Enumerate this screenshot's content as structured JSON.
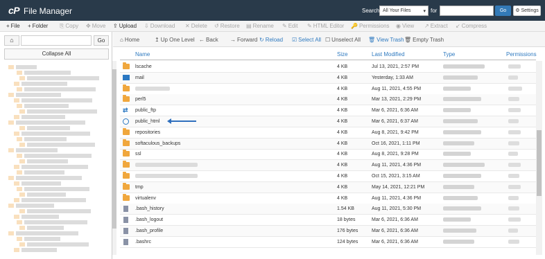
{
  "header": {
    "logo": "cP",
    "title": "File Manager",
    "search_label": "Search",
    "scope_value": "All Your Files",
    "for_label": "for",
    "go_label": "Go",
    "settings_label": "Settings"
  },
  "toolbar": [
    {
      "icon": "+",
      "label": "File",
      "enabled": true
    },
    {
      "icon": "+",
      "label": "Folder",
      "enabled": true
    },
    {
      "icon": "⎘",
      "label": "Copy",
      "enabled": false
    },
    {
      "icon": "✥",
      "label": "Move",
      "enabled": false
    },
    {
      "icon": "⇪",
      "label": "Upload",
      "enabled": true
    },
    {
      "icon": "⇩",
      "label": "Download",
      "enabled": false
    },
    {
      "icon": "✕",
      "label": "Delete",
      "enabled": false
    },
    {
      "icon": "↺",
      "label": "Restore",
      "enabled": false
    },
    {
      "icon": "▤",
      "label": "Rename",
      "enabled": false
    },
    {
      "icon": "✎",
      "label": "Edit",
      "enabled": false
    },
    {
      "icon": "✎",
      "label": "HTML Editor",
      "enabled": false
    },
    {
      "icon": "🔑",
      "label": "Permissions",
      "enabled": false
    },
    {
      "icon": "◉",
      "label": "View",
      "enabled": false
    },
    {
      "icon": "↗",
      "label": "Extract",
      "enabled": false
    },
    {
      "icon": "↙",
      "label": "Compress",
      "enabled": false
    }
  ],
  "left": {
    "go_label": "Go",
    "collapse_label": "Collapse All"
  },
  "nav": [
    {
      "icon": "⌂",
      "label": "Home",
      "style": "gray"
    },
    {
      "icon": "↥",
      "label": "Up One Level",
      "style": "gray"
    },
    {
      "icon": "←",
      "label": "Back",
      "style": "gray"
    },
    {
      "icon": "→",
      "label": "Forward",
      "style": "gray"
    },
    {
      "icon": "↻",
      "label": "Reload",
      "style": "blue"
    },
    {
      "icon": "☑",
      "label": "Select All",
      "style": "blue"
    },
    {
      "icon": "☐",
      "label": "Unselect All",
      "style": "gray"
    },
    {
      "icon": "🗑",
      "label": "View Trash",
      "style": "blue"
    },
    {
      "icon": "🗑",
      "label": "Empty Trash",
      "style": "gray"
    }
  ],
  "columns": {
    "name": "Name",
    "size": "Size",
    "modified": "Last Modified",
    "type": "Type",
    "permissions": "Permissions"
  },
  "files": [
    {
      "icon": "folder",
      "name": "lscache",
      "size": "4 KB",
      "modified": "Jul 13, 2021, 2:57 PM"
    },
    {
      "icon": "mail",
      "name": "mail",
      "size": "4 KB",
      "modified": "Yesterday, 1:33 AM"
    },
    {
      "icon": "folder",
      "name": "",
      "size": "4 KB",
      "modified": "Aug 11, 2021, 4:55 PM"
    },
    {
      "icon": "folder",
      "name": "perl5",
      "size": "4 KB",
      "modified": "Mar 13, 2021, 2:29 PM"
    },
    {
      "icon": "link",
      "name": "public_ftp",
      "size": "4 KB",
      "modified": "Mar 6, 2021, 6:36 AM"
    },
    {
      "icon": "globe",
      "name": "public_html",
      "size": "4 KB",
      "modified": "Mar 6, 2021, 6:37 AM"
    },
    {
      "icon": "folder",
      "name": "repositories",
      "size": "4 KB",
      "modified": "Aug 8, 2021, 9:42 PM"
    },
    {
      "icon": "folder",
      "name": "softaculous_backups",
      "size": "4 KB",
      "modified": "Oct 16, 2021, 1:11 PM"
    },
    {
      "icon": "folder",
      "name": "ssl",
      "size": "4 KB",
      "modified": "Aug 8, 2021, 9:28 PM"
    },
    {
      "icon": "folder",
      "name": "",
      "size": "4 KB",
      "modified": "Aug 11, 2021, 4:36 PM"
    },
    {
      "icon": "folder",
      "name": "",
      "size": "4 KB",
      "modified": "Oct 15, 2021, 3:15 AM"
    },
    {
      "icon": "folder",
      "name": "tmp",
      "size": "4 KB",
      "modified": "May 14, 2021, 12:21 PM"
    },
    {
      "icon": "folder",
      "name": "virtualenv",
      "size": "4 KB",
      "modified": "Aug 11, 2021, 4:36 PM"
    },
    {
      "icon": "file",
      "name": ".bash_history",
      "size": "1.54 KB",
      "modified": "Aug 11, 2021, 5:30 PM"
    },
    {
      "icon": "file",
      "name": ".bash_logout",
      "size": "18 bytes",
      "modified": "Mar 6, 2021, 6:36 AM"
    },
    {
      "icon": "file",
      "name": ".bash_profile",
      "size": "176 bytes",
      "modified": "Mar 6, 2021, 6:36 AM"
    },
    {
      "icon": "file",
      "name": ".bashrc",
      "size": "124 bytes",
      "modified": "Mar 6, 2021, 6:36 AM"
    }
  ],
  "colors": {
    "header_bg": "#293a4a",
    "accent": "#2f7ac0",
    "folder": "#f0a73d"
  }
}
